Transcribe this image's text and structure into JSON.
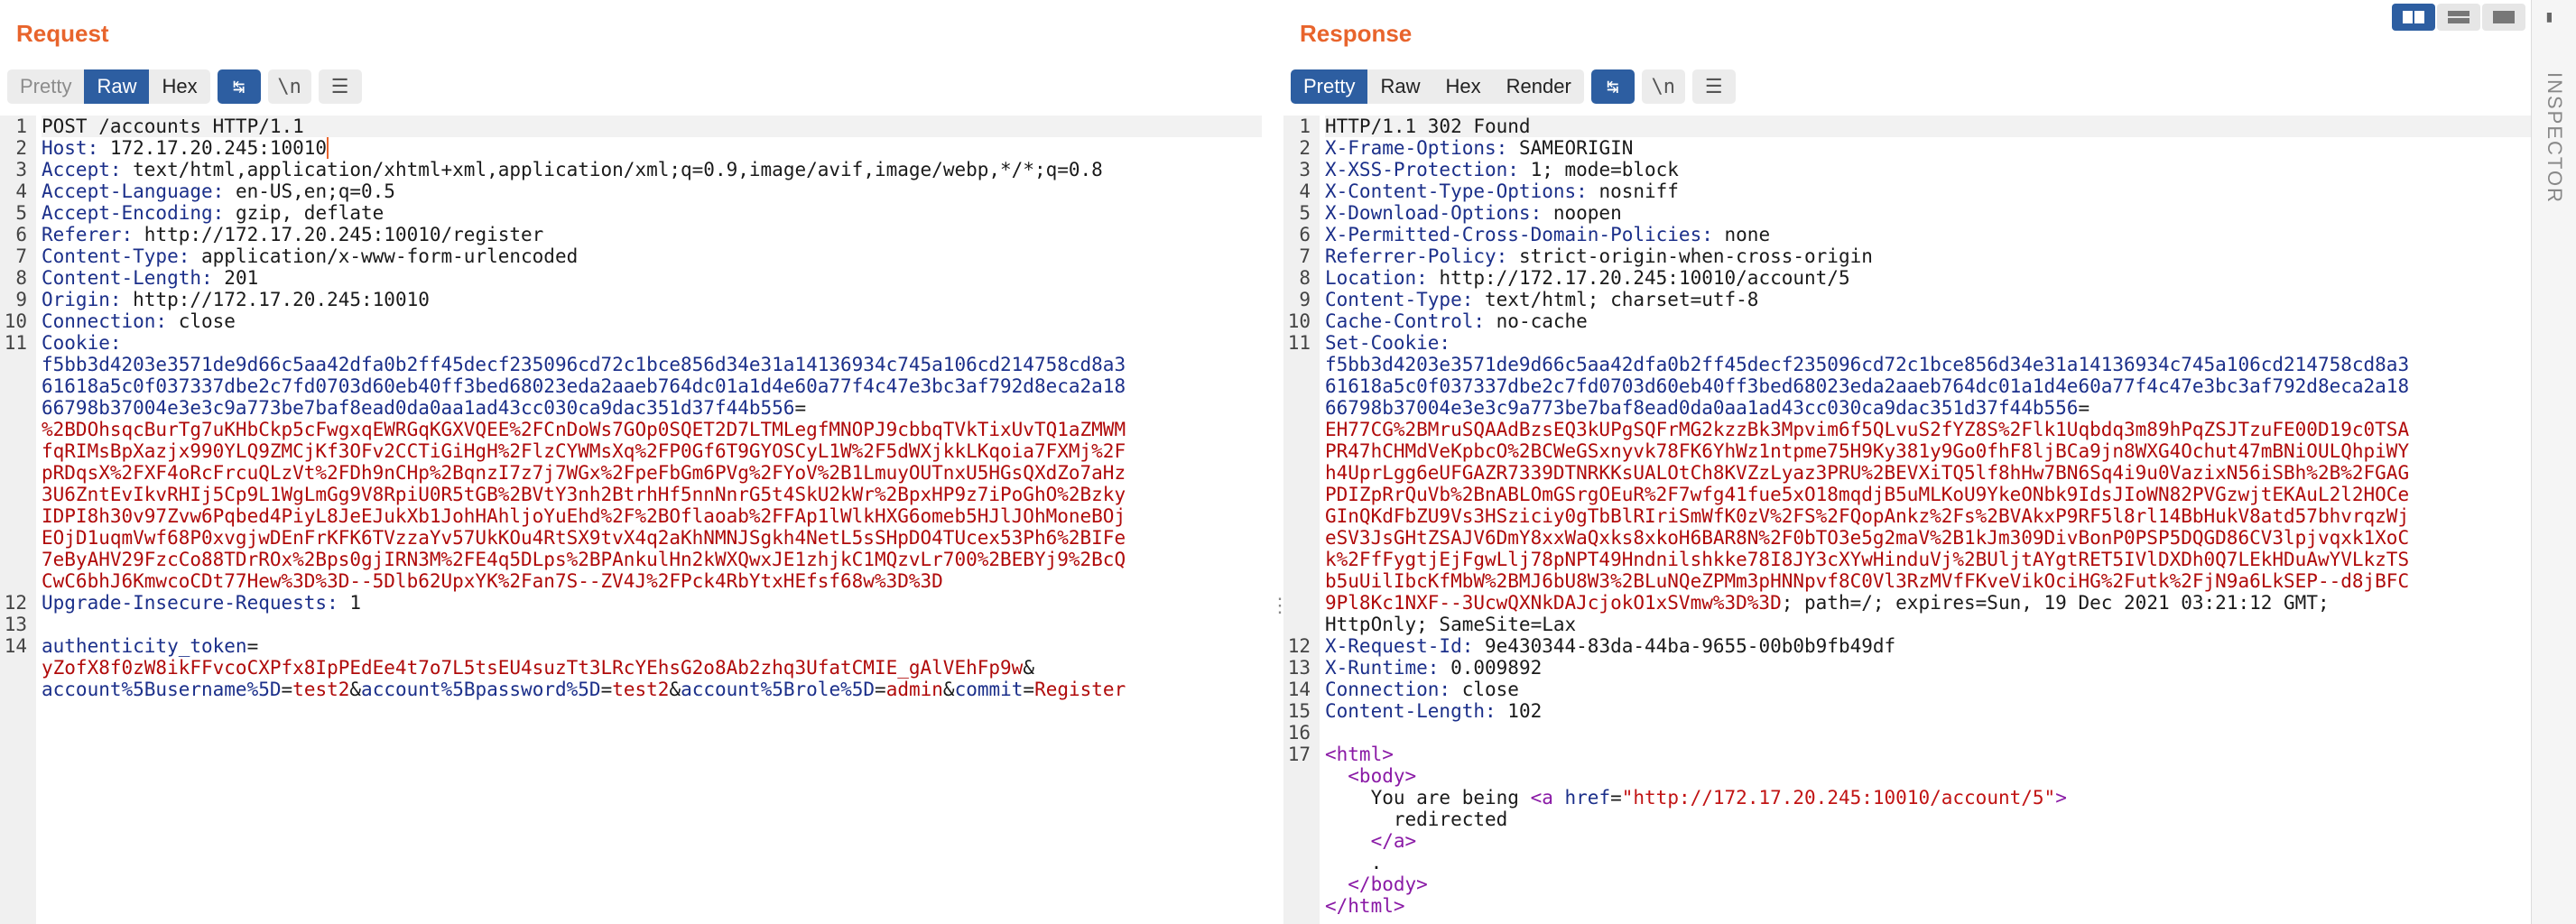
{
  "request": {
    "title": "Request",
    "tabs": [
      {
        "label": "Pretty",
        "active": false,
        "dim": true
      },
      {
        "label": "Raw",
        "active": true
      },
      {
        "label": "Hex",
        "active": false
      }
    ],
    "lines": [
      {
        "n": "1",
        "segs": [
          {
            "t": "POST /accounts HTTP/1.1",
            "c": "v"
          }
        ]
      },
      {
        "n": "2",
        "segs": [
          {
            "t": "Host:",
            "c": "hn"
          },
          {
            "t": " 172.17.20.245:10010",
            "c": "v"
          }
        ]
      },
      {
        "n": "3",
        "segs": [
          {
            "t": "Accept:",
            "c": "hn"
          },
          {
            "t": " text/html,application/xhtml+xml,application/xml;q=0.9,image/avif,image/webp,*/*;q=0.8",
            "c": "v"
          }
        ]
      },
      {
        "n": "4",
        "segs": [
          {
            "t": "Accept-Language:",
            "c": "hn"
          },
          {
            "t": " en-US,en;q=0.5",
            "c": "v"
          }
        ]
      },
      {
        "n": "5",
        "segs": [
          {
            "t": "Accept-Encoding:",
            "c": "hn"
          },
          {
            "t": " gzip, deflate",
            "c": "v"
          }
        ]
      },
      {
        "n": "6",
        "segs": [
          {
            "t": "Referer:",
            "c": "hn"
          },
          {
            "t": " http://172.17.20.245:10010/register",
            "c": "v"
          }
        ]
      },
      {
        "n": "7",
        "segs": [
          {
            "t": "Content-Type:",
            "c": "hn"
          },
          {
            "t": " application/x-www-form-urlencoded",
            "c": "v"
          }
        ]
      },
      {
        "n": "8",
        "segs": [
          {
            "t": "Content-Length:",
            "c": "hn"
          },
          {
            "t": " 201",
            "c": "v"
          }
        ]
      },
      {
        "n": "9",
        "segs": [
          {
            "t": "Origin:",
            "c": "hn"
          },
          {
            "t": " http://172.17.20.245:10010",
            "c": "v"
          }
        ]
      },
      {
        "n": "10",
        "segs": [
          {
            "t": "Connection:",
            "c": "hn"
          },
          {
            "t": " close",
            "c": "v"
          }
        ]
      },
      {
        "n": "11",
        "segs": [
          {
            "t": "Cookie:",
            "c": "hn"
          }
        ]
      },
      {
        "n": "",
        "segs": [
          {
            "t": "f5bb3d4203e3571de9d66c5aa42dfa0b2ff45decf235096cd72c1bce856d34e31a14136934c745a106cd214758cd8a3",
            "c": "blue"
          }
        ]
      },
      {
        "n": "",
        "segs": [
          {
            "t": "61618a5c0f037337dbe2c7fd0703d60eb40ff3bed68023eda2aaeb764dc01a1d4e60a77f4c47e3bc3af792d8eca2a18",
            "c": "blue"
          }
        ]
      },
      {
        "n": "",
        "segs": [
          {
            "t": "66798b37004e3e3c9a773be7baf8ead0da0aa1ad43cc030ca9dac351d37f44b556",
            "c": "blue"
          },
          {
            "t": "=",
            "c": "v"
          }
        ]
      },
      {
        "n": "",
        "segs": [
          {
            "t": "%2BDOhsqcBurTg7uKHbCkp5cFwgxqEWRGqKGXVQEE%2FCnDoWs7GOp0SQET2D7LTMLegfMNOPJ9cbbqTVkTixUvTQ1aZMWM",
            "c": "red"
          }
        ]
      },
      {
        "n": "",
        "segs": [
          {
            "t": "fqRIMsBpXazjx990YLQ9ZMCjKf3OFv2CCTiGiHgH%2FlzCYWMsXq%2FP0Gf6T9GYOSCyL1W%2F5dWXjkkLKqoia7FXMj%2F",
            "c": "red"
          }
        ]
      },
      {
        "n": "",
        "segs": [
          {
            "t": "pRDqsX%2FXF4oRcFrcuQLzVt%2FDh9nCHp%2BqnzI7z7j7WGx%2FpeFbGm6PVg%2FYoV%2B1LmuyOUTnxU5HGsQXdZo7aHz",
            "c": "red"
          }
        ]
      },
      {
        "n": "",
        "segs": [
          {
            "t": "3U6ZntEvIkvRHIj5Cp9L1WgLmGg9V8RpiU0R5tGB%2BVtY3nh2BtrhHf5nnNnrG5t4SkU2kWr%2BpxHP9z7iPoGhO%2Bzky",
            "c": "red"
          }
        ]
      },
      {
        "n": "",
        "segs": [
          {
            "t": "IDPI8h30v97Zvw6Pqbed4PiyL8JeEJukXb1JohHAhljoYuEhd%2F%2BOflaoab%2FFAp1lWlkHXG6omeb5HJlJOhMoneBOj",
            "c": "red"
          }
        ]
      },
      {
        "n": "",
        "segs": [
          {
            "t": "EOjD1uqmVwf68P0xvgjwDEnFrKFK6TVzzaYv57UkKOu4RtSX9tvX4q2aKhNMNJSgkh4NetL5sSHpDO4TUcex53Ph6%2BIFe",
            "c": "red"
          }
        ]
      },
      {
        "n": "",
        "segs": [
          {
            "t": "7eByAHV29FzcCo88TDrROx%2Bps0gjIRN3M%2FE4q5DLps%2BPAnkulHn2kWXQwxJE1zhjkC1MQzvLr700%2BEBYj9%2BcQ",
            "c": "red"
          }
        ]
      },
      {
        "n": "",
        "segs": [
          {
            "t": "CwC6bhJ6KmwcoCDt77Hew%3D%3D--5Dlb62UpxYK%2Fan7S--ZV4J%2FPck4RbYtxHEfsf68w%3D%3D",
            "c": "red"
          }
        ]
      },
      {
        "n": "12",
        "segs": [
          {
            "t": "Upgrade-Insecure-Requests:",
            "c": "hn"
          },
          {
            "t": " 1",
            "c": "v"
          }
        ]
      },
      {
        "n": "13",
        "segs": [
          {
            "t": "",
            "c": "v"
          }
        ]
      },
      {
        "n": "14",
        "segs": [
          {
            "t": "authenticity_token",
            "c": "blue"
          },
          {
            "t": "=",
            "c": "v"
          }
        ]
      },
      {
        "n": "",
        "segs": [
          {
            "t": "yZofX8f0zW8ikFFvcoCXPfx8IpPEdEe4t7o7L5tsEU4suzTt3LRcYEhsG2o8Ab2zhq3UfatCMIE_gAlVEhFp9w",
            "c": "red"
          },
          {
            "t": "&",
            "c": "v"
          }
        ]
      },
      {
        "n": "",
        "segs": [
          {
            "t": "account%5Busername%5D",
            "c": "blue"
          },
          {
            "t": "=",
            "c": "v"
          },
          {
            "t": "test2",
            "c": "red"
          },
          {
            "t": "&",
            "c": "v"
          },
          {
            "t": "account%5Bpassword%5D",
            "c": "blue"
          },
          {
            "t": "=",
            "c": "v"
          },
          {
            "t": "test2",
            "c": "red"
          },
          {
            "t": "&",
            "c": "v"
          },
          {
            "t": "account%5Brole%5D",
            "c": "blue"
          },
          {
            "t": "=",
            "c": "v"
          },
          {
            "t": "admin",
            "c": "red"
          },
          {
            "t": "&",
            "c": "v"
          },
          {
            "t": "commit",
            "c": "blue"
          },
          {
            "t": "=",
            "c": "v"
          },
          {
            "t": "Register",
            "c": "red"
          }
        ]
      }
    ]
  },
  "response": {
    "title": "Response",
    "tabs": [
      {
        "label": "Pretty",
        "active": true
      },
      {
        "label": "Raw",
        "active": false
      },
      {
        "label": "Hex",
        "active": false
      },
      {
        "label": "Render",
        "active": false
      }
    ],
    "lines": [
      {
        "n": "1",
        "segs": [
          {
            "t": "HTTP/1.1 302 Found",
            "c": "v"
          }
        ]
      },
      {
        "n": "2",
        "segs": [
          {
            "t": "X-Frame-Options:",
            "c": "hn"
          },
          {
            "t": " SAMEORIGIN",
            "c": "v"
          }
        ]
      },
      {
        "n": "3",
        "segs": [
          {
            "t": "X-XSS-Protection:",
            "c": "hn"
          },
          {
            "t": " 1; mode=block",
            "c": "v"
          }
        ]
      },
      {
        "n": "4",
        "segs": [
          {
            "t": "X-Content-Type-Options:",
            "c": "hn"
          },
          {
            "t": " nosniff",
            "c": "v"
          }
        ]
      },
      {
        "n": "5",
        "segs": [
          {
            "t": "X-Download-Options:",
            "c": "hn"
          },
          {
            "t": " noopen",
            "c": "v"
          }
        ]
      },
      {
        "n": "6",
        "segs": [
          {
            "t": "X-Permitted-Cross-Domain-Policies:",
            "c": "hn"
          },
          {
            "t": " none",
            "c": "v"
          }
        ]
      },
      {
        "n": "7",
        "segs": [
          {
            "t": "Referrer-Policy:",
            "c": "hn"
          },
          {
            "t": " strict-origin-when-cross-origin",
            "c": "v"
          }
        ]
      },
      {
        "n": "8",
        "segs": [
          {
            "t": "Location:",
            "c": "hn"
          },
          {
            "t": " http://172.17.20.245:10010/account/5",
            "c": "v"
          }
        ]
      },
      {
        "n": "9",
        "segs": [
          {
            "t": "Content-Type:",
            "c": "hn"
          },
          {
            "t": " text/html; charset=utf-8",
            "c": "v"
          }
        ]
      },
      {
        "n": "10",
        "segs": [
          {
            "t": "Cache-Control:",
            "c": "hn"
          },
          {
            "t": " no-cache",
            "c": "v"
          }
        ]
      },
      {
        "n": "11",
        "segs": [
          {
            "t": "Set-Cookie:",
            "c": "hn"
          }
        ]
      },
      {
        "n": "",
        "segs": [
          {
            "t": "f5bb3d4203e3571de9d66c5aa42dfa0b2ff45decf235096cd72c1bce856d34e31a14136934c745a106cd214758cd8a3",
            "c": "blue"
          }
        ]
      },
      {
        "n": "",
        "segs": [
          {
            "t": "61618a5c0f037337dbe2c7fd0703d60eb40ff3bed68023eda2aaeb764dc01a1d4e60a77f4c47e3bc3af792d8eca2a18",
            "c": "blue"
          }
        ]
      },
      {
        "n": "",
        "segs": [
          {
            "t": "66798b37004e3e3c9a773be7baf8ead0da0aa1ad43cc030ca9dac351d37f44b556",
            "c": "blue"
          },
          {
            "t": "=",
            "c": "v"
          }
        ]
      },
      {
        "n": "",
        "segs": [
          {
            "t": "EH77CG%2BMruSQAAdBzsEQ3kUPgSQFrMG2kzzBk3Mpvim6f5QLvuS2fYZ8S%2Flk1Uqbdq3m89hPqZSJTzuFE00D19c0TSA",
            "c": "red"
          }
        ]
      },
      {
        "n": "",
        "segs": [
          {
            "t": "PR47hCHMdVeKpbcO%2BCWeGSxnyvk78FK6YhWz1ntpme75H9Ky381y9Go0fhF8ljBCa9jn8WXG4Ochut47mBNiOULQhpiWY",
            "c": "red"
          }
        ]
      },
      {
        "n": "",
        "segs": [
          {
            "t": "h4UprLgg6eUFGAZR7339DTNRKKsUALOtCh8KVZzLyaz3PRU%2BEVXiTQ5lf8hHw7BN6Sq4i9u0VazixN56iSBh%2B%2FGAG",
            "c": "red"
          }
        ]
      },
      {
        "n": "",
        "segs": [
          {
            "t": "PDIZpRrQuVb%2BnABLOmGSrgOEuR%2F7wfg41fue5xO18mqdjB5uMLKoU9YkeONbk9IdsJIoWN82PVGzwjtEKAuL2l2HOCe",
            "c": "red"
          }
        ]
      },
      {
        "n": "",
        "segs": [
          {
            "t": "GInQKdFbZU9Vs3HSziciy0gTbBlRIriSmWfK0zV%2FS%2FQopAnkz%2Fs%2BVAkxP9RF5l8rl14BbHukV8atd57bhvrqzWj",
            "c": "red"
          }
        ]
      },
      {
        "n": "",
        "segs": [
          {
            "t": "eSV3JsGHtZSAJV6DmY8xxWaQxks8xkoH6BAR8N%2F0bTO3e5g2maV%2B1kJm309DivBonP0PSP5DQGD86CV3lpjvqxk1XoC",
            "c": "red"
          }
        ]
      },
      {
        "n": "",
        "segs": [
          {
            "t": "k%2FfFygtjEjFgwLlj78pNPT49Hndnilshkke78I8JY3cXYwHinduVj%2BUljtAYgtRET5IVlDXDh0Q7LEkHDuAwYVLkzTS",
            "c": "red"
          }
        ]
      },
      {
        "n": "",
        "segs": [
          {
            "t": "b5uUilIbcKfMbW%2BMJ6bU8W3%2BLuNQeZPMm3pHNNpvf8C0Vl3RzMVfFKveVikOciHG%2Futk%2FjN9a6LkSEP--d8jBFC",
            "c": "red"
          }
        ]
      },
      {
        "n": "",
        "segs": [
          {
            "t": "9Pl8Kc1NXF--3UcwQXNkDAJcjokO1xSVmw%3D%3D",
            "c": "red"
          },
          {
            "t": "; path=/; expires=Sun, 19 Dec 2021 03:21:12 GMT;",
            "c": "v"
          }
        ]
      },
      {
        "n": "",
        "segs": [
          {
            "t": "HttpOnly; SameSite=Lax",
            "c": "v"
          }
        ]
      },
      {
        "n": "12",
        "segs": [
          {
            "t": "X-Request-Id:",
            "c": "hn"
          },
          {
            "t": " 9e430344-83da-44ba-9655-00b0b9fb49df",
            "c": "v"
          }
        ]
      },
      {
        "n": "13",
        "segs": [
          {
            "t": "X-Runtime:",
            "c": "hn"
          },
          {
            "t": " 0.009892",
            "c": "v"
          }
        ]
      },
      {
        "n": "14",
        "segs": [
          {
            "t": "Connection:",
            "c": "hn"
          },
          {
            "t": " close",
            "c": "v"
          }
        ]
      },
      {
        "n": "15",
        "segs": [
          {
            "t": "Content-Length:",
            "c": "hn"
          },
          {
            "t": " 102",
            "c": "v"
          }
        ]
      },
      {
        "n": "16",
        "segs": [
          {
            "t": "",
            "c": "v"
          }
        ]
      },
      {
        "n": "17",
        "segs": [
          {
            "t": "<html>",
            "c": "tag"
          }
        ]
      },
      {
        "n": "",
        "segs": [
          {
            "t": "  <body>",
            "c": "tag"
          }
        ]
      },
      {
        "n": "",
        "segs": [
          {
            "t": "    You are being ",
            "c": "v"
          },
          {
            "t": "<a ",
            "c": "tag"
          },
          {
            "t": "href",
            "c": "attr"
          },
          {
            "t": "=",
            "c": "v"
          },
          {
            "t": "\"http://172.17.20.245:10010/account/5\"",
            "c": "aval"
          },
          {
            "t": ">",
            "c": "tag"
          }
        ]
      },
      {
        "n": "",
        "segs": [
          {
            "t": "      redirected",
            "c": "v"
          }
        ]
      },
      {
        "n": "",
        "segs": [
          {
            "t": "    </a>",
            "c": "tag"
          }
        ]
      },
      {
        "n": "",
        "segs": [
          {
            "t": "    .",
            "c": "v"
          }
        ]
      },
      {
        "n": "",
        "segs": [
          {
            "t": "  </body>",
            "c": "tag"
          }
        ]
      },
      {
        "n": "",
        "segs": [
          {
            "t": "</html>",
            "c": "tag"
          }
        ]
      }
    ]
  },
  "toolbar_icons": {
    "wrap": "↹",
    "newline": "\\n",
    "menu": "☰"
  },
  "inspector": {
    "label": "INSPECTOR"
  },
  "colors": {
    "accent": "#e8642c",
    "active_tab": "#2d5ea1",
    "header_name": "#1b2f8a",
    "value_red": "#b00a0a",
    "html_tag": "#8a1aa6"
  }
}
